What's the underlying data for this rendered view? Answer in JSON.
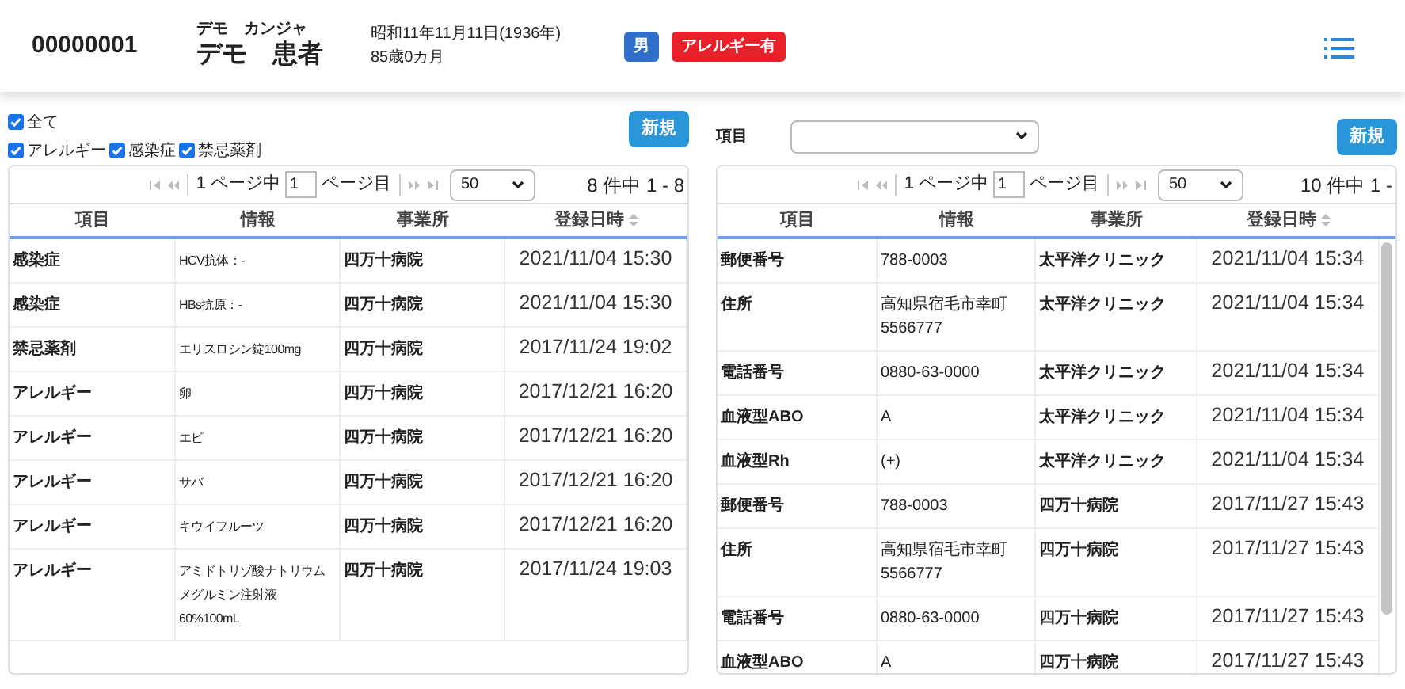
{
  "header": {
    "patient_id": "00000001",
    "kana": "デモ　カンジャ",
    "name": "デモ　患者",
    "dob": "昭和11年11月11日(1936年)",
    "age": "85歳0カ月",
    "badges": [
      {
        "label": "男",
        "color": "#2f6fc9"
      },
      {
        "label": "アレルギー有",
        "color": "#e8202a"
      }
    ]
  },
  "left": {
    "filters": [
      {
        "label": "全て",
        "checked": true
      },
      {
        "label": "アレルギー",
        "checked": true
      },
      {
        "label": "感染症",
        "checked": true
      },
      {
        "label": "禁忌薬剤",
        "checked": true
      }
    ],
    "new_button": "新規",
    "pager": {
      "pages": "1 ページ中",
      "page": "1",
      "page_suffix": "ページ目",
      "per_page": "50",
      "count": "8 件中 1 - 8"
    },
    "columns": [
      {
        "label": "項目",
        "sortable": false
      },
      {
        "label": "情報",
        "sortable": false
      },
      {
        "label": "事業所",
        "sortable": false
      },
      {
        "label": "登録日時",
        "sortable": true
      }
    ],
    "rows": [
      [
        "感染症",
        "HCV抗体：-",
        "四万十病院",
        "2021/11/04 15:30"
      ],
      [
        "感染症",
        "HBs抗原：-",
        "四万十病院",
        "2021/11/04 15:30"
      ],
      [
        "禁忌薬剤",
        "エリスロシン錠100mg",
        "四万十病院",
        "2017/11/24 19:02"
      ],
      [
        "アレルギー",
        "卵",
        "四万十病院",
        "2017/12/21 16:20"
      ],
      [
        "アレルギー",
        "エビ",
        "四万十病院",
        "2017/12/21 16:20"
      ],
      [
        "アレルギー",
        "サバ",
        "四万十病院",
        "2017/12/21 16:20"
      ],
      [
        "アレルギー",
        "キウイフルーツ",
        "四万十病院",
        "2017/12/21 16:20"
      ],
      [
        "アレルギー",
        "アミドトリゾ酸ナトリウムメグルミン注射液 60%100mL",
        "四万十病院",
        "2017/11/24 19:03"
      ]
    ]
  },
  "right": {
    "filter_label": "項目",
    "new_button": "新規",
    "pager": {
      "pages": "1 ページ中",
      "page": "1",
      "page_suffix": "ページ目",
      "per_page": "50",
      "count": "10 件中 1 -"
    },
    "columns": [
      {
        "label": "項目",
        "sortable": false
      },
      {
        "label": "情報",
        "sortable": false
      },
      {
        "label": "事業所",
        "sortable": false
      },
      {
        "label": "登録日時",
        "sortable": true
      }
    ],
    "rows": [
      [
        "郵便番号",
        "788-0003",
        "太平洋クリニック",
        "2021/11/04 15:34"
      ],
      [
        "住所",
        "高知県宿毛市幸町5566777",
        "太平洋クリニック",
        "2021/11/04 15:34"
      ],
      [
        "電話番号",
        "0880-63-0000",
        "太平洋クリニック",
        "2021/11/04 15:34"
      ],
      [
        "血液型ABO",
        "A",
        "太平洋クリニック",
        "2021/11/04 15:34"
      ],
      [
        "血液型Rh",
        "(+)",
        "太平洋クリニック",
        "2021/11/04 15:34"
      ],
      [
        "郵便番号",
        "788-0003",
        "四万十病院",
        "2017/11/27 15:43"
      ],
      [
        "住所",
        "高知県宿毛市幸町5566777",
        "四万十病院",
        "2017/11/27 15:43"
      ],
      [
        "電話番号",
        "0880-63-0000",
        "四万十病院",
        "2017/11/27 15:43"
      ],
      [
        "血液型ABO",
        "A",
        "四万十病院",
        "2017/11/27 15:43"
      ]
    ]
  }
}
